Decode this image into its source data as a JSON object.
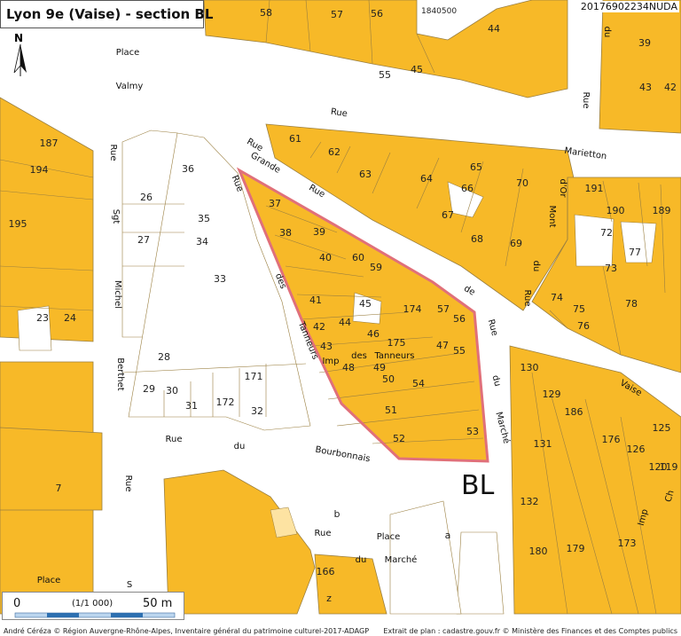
{
  "title": "Lyon 9e (Vaise) - section BL",
  "reference_id": "20176902234NUDA",
  "grid_coord": "1840500",
  "section_label": "BL",
  "north_label": "N",
  "scale": {
    "left": "0",
    "middle": "(1/1 000)",
    "right": "50 m"
  },
  "credits": {
    "left": "André Céréza © Région Auvergne-Rhône-Alpes, Inventaire général du patrimoine culturel-2017-ADAGP",
    "right": "Extrait de plan : cadastre.gouv.fr © Ministère des Finances et des Comptes publics"
  },
  "colors": {
    "parcel": "#f7b928",
    "road": "#ffffff",
    "outline": "#9a7f40",
    "highlight": "#e0707a",
    "annex": "#fde3a2"
  },
  "street_labels": [
    "Place",
    "Valmy",
    "Rue",
    "Marietton",
    "Rue",
    "Grande",
    "Rue",
    "de",
    "Vaise",
    "Rue",
    "des",
    "Tanneurs",
    "Imp",
    "des",
    "Tanneurs",
    "Rue",
    "Sgt",
    "Michel",
    "Berthet",
    "Rue",
    "du",
    "Bourbonnais",
    "Rue",
    "du",
    "Marché",
    "Place",
    "du",
    "Marché",
    "Rue",
    "du",
    "Mont",
    "d'Or",
    "Rue",
    "du",
    "Rue",
    "Imp",
    "Ch",
    "Place",
    "Rue",
    "S"
  ],
  "parcel_numbers": [
    "58",
    "57",
    "56",
    "44",
    "39",
    "45",
    "55",
    "43",
    "42",
    "187",
    "194",
    "195",
    "23",
    "24",
    "36",
    "26",
    "35",
    "27",
    "34",
    "33",
    "28",
    "171",
    "29",
    "30",
    "31",
    "172",
    "32",
    "61",
    "62",
    "63",
    "64",
    "65",
    "66",
    "70",
    "67",
    "68",
    "69",
    "191",
    "190",
    "189",
    "72",
    "77",
    "73",
    "74",
    "75",
    "76",
    "78",
    "37",
    "38",
    "39",
    "40",
    "60",
    "59",
    "41",
    "45",
    "42",
    "44",
    "43",
    "46",
    "175",
    "174",
    "57",
    "56",
    "47",
    "48",
    "49",
    "50",
    "54",
    "55",
    "51",
    "52",
    "53",
    "130",
    "129",
    "186",
    "131",
    "176",
    "125",
    "126",
    "120",
    "119",
    "132",
    "180",
    "179",
    "173",
    "7",
    "166",
    "b",
    "a",
    "z"
  ]
}
